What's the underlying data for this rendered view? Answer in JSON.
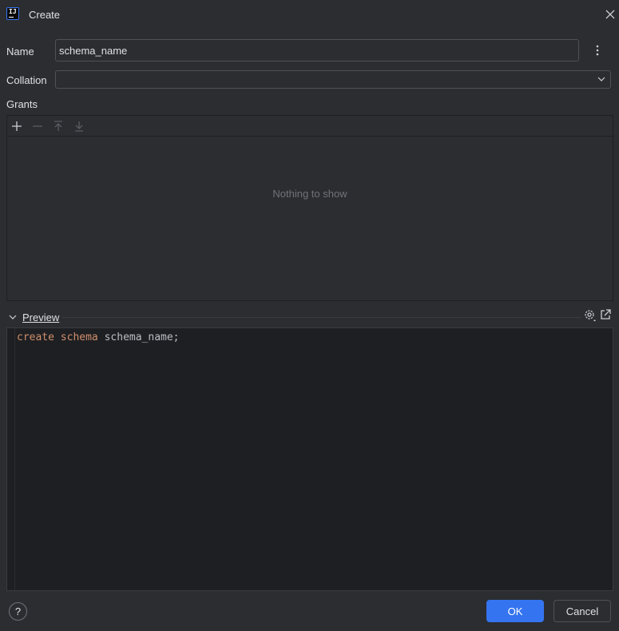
{
  "window": {
    "title": "Create",
    "logo_text": "IJ"
  },
  "form": {
    "name_label": "Name",
    "name_value": "schema_name",
    "collation_label": "Collation",
    "collation_value": ""
  },
  "grants": {
    "label": "Grants",
    "empty_text": "Nothing to show",
    "toolbar": [
      "add-icon",
      "remove-icon",
      "move-up-icon",
      "move-down-icon"
    ]
  },
  "preview": {
    "label": "Preview",
    "code": {
      "kw1": "create",
      "kw2": "schema",
      "rest": "schema_name;"
    }
  },
  "footer": {
    "help": "?",
    "ok": "OK",
    "cancel": "Cancel"
  },
  "colors": {
    "accent": "#3574f0",
    "keyword": "#cf8e6d",
    "background": "#2b2d30",
    "editor_bg": "#1e1f22"
  }
}
